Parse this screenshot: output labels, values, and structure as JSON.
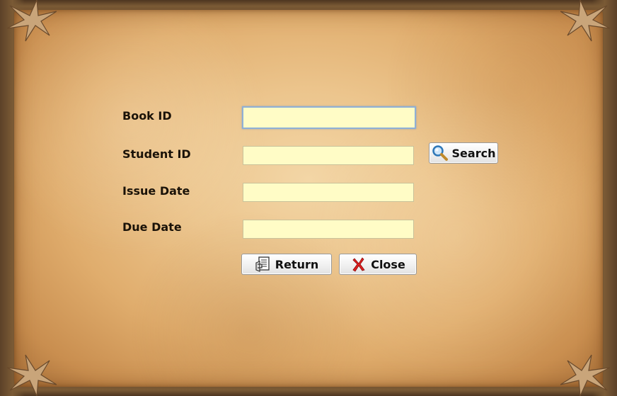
{
  "form": {
    "book_id_label": "Book ID",
    "student_id_label": "Student ID",
    "issue_date_label": "Issue Date",
    "due_date_label": "Due Date",
    "book_id_value": "",
    "student_id_value": "",
    "issue_date_value": "",
    "due_date_value": ""
  },
  "buttons": {
    "search_label": "Search",
    "return_label": "Return",
    "close_label": "Close",
    "search_icon": "magnifier-icon",
    "return_icon": "book-stack-icon",
    "close_icon": "red-x-icon"
  },
  "colors": {
    "field_background": "#fffcc6",
    "focus_border": "#8fb0d6",
    "close_icon": "#e02020",
    "search_icon": "#3a86c8"
  }
}
